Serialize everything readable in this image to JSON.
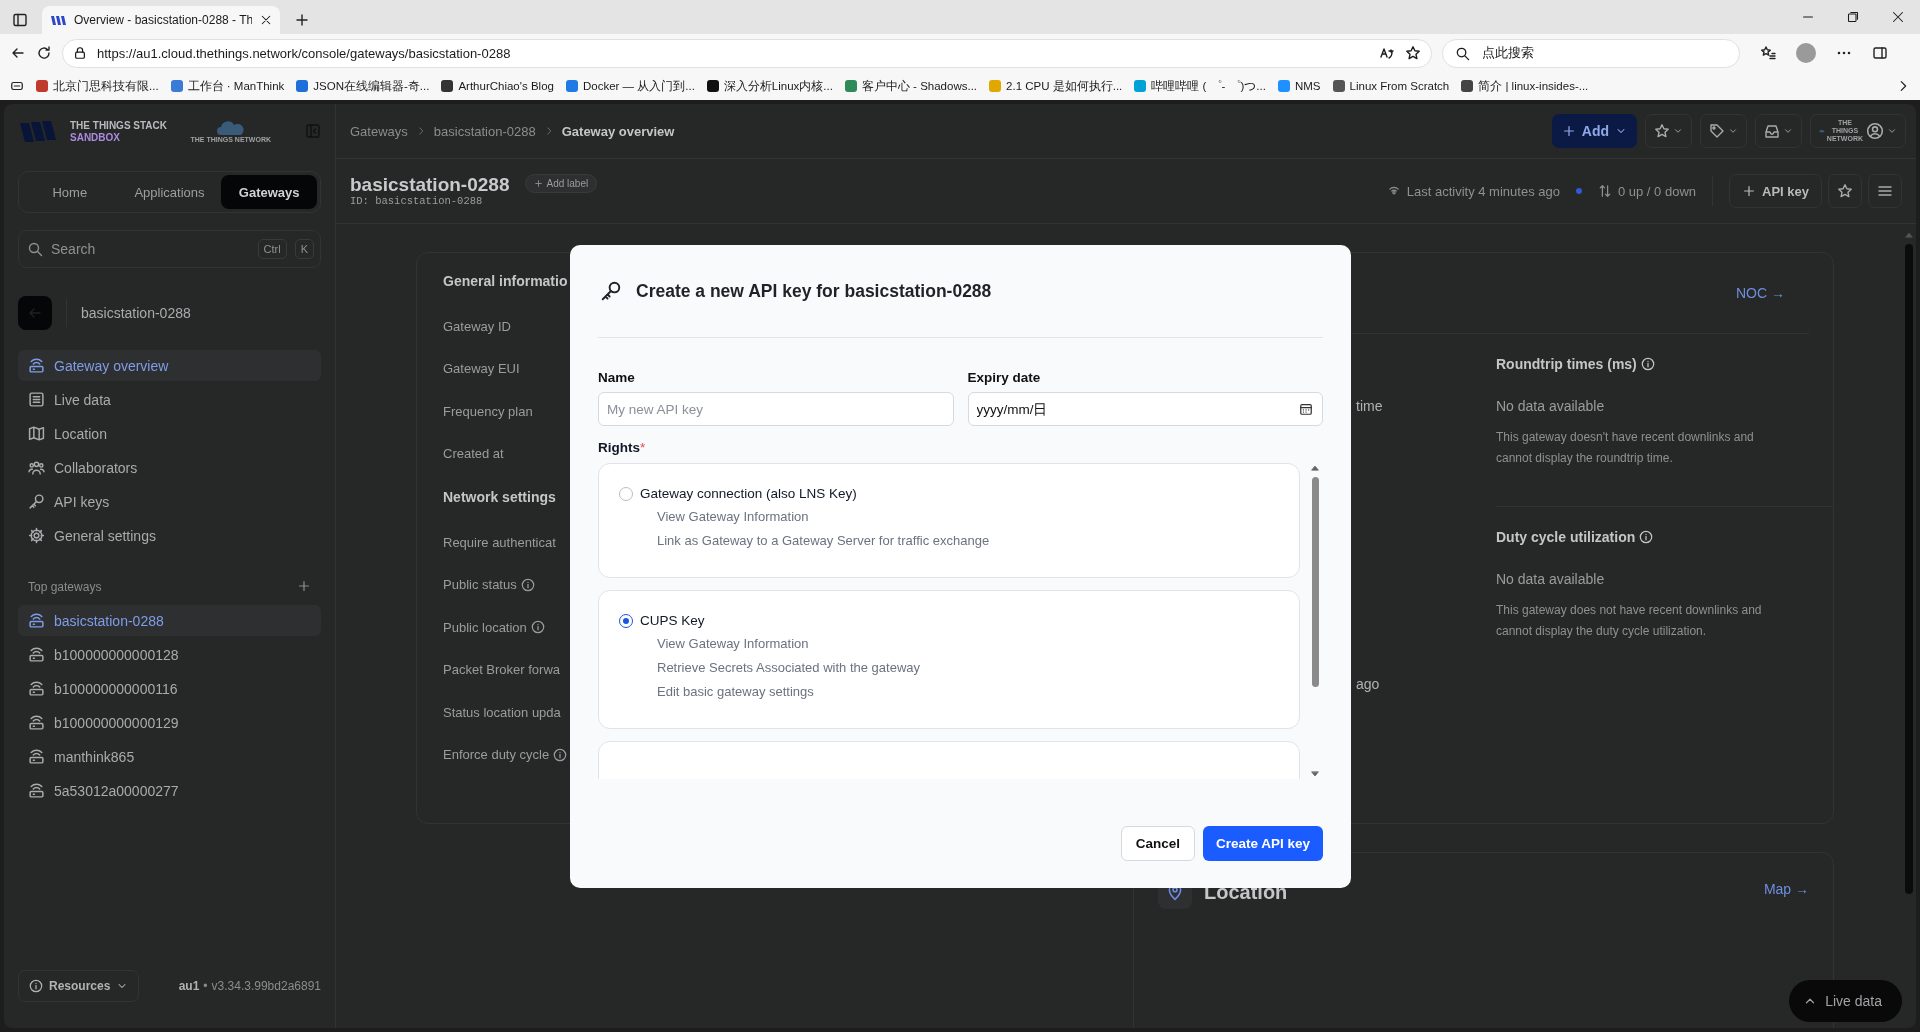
{
  "browser": {
    "tabs": [
      {
        "title": "Overview - basicstation-0288 - Th",
        "selected": true
      }
    ],
    "url": "https://au1.cloud.thethings.network/console/gateways/basicstation-0288",
    "search_placeholder": "点此搜索",
    "bookmarks": [
      "北京门思科技有限...",
      "工作台 · ManThink",
      "JSON在线编辑器-奇...",
      "ArthurChiao's Blog",
      "Docker — 从入门到...",
      "深入分析Linux内核...",
      "客户中心 - Shadows...",
      "2.1 CPU 是如何执行...",
      "哔哩哔哩 ( ゜- ゜)つ...",
      "NMS",
      "Linux From Scratch",
      "简介 | linux-insides-..."
    ]
  },
  "sidebar": {
    "brand": [
      "THE THINGS STACK",
      "SANDBOX"
    ],
    "partner_logo": "THE THINGS NETWORK",
    "nav_tabs": [
      {
        "label": "Home",
        "selected": false
      },
      {
        "label": "Applications",
        "selected": false
      },
      {
        "label": "Gateways",
        "selected": true
      }
    ],
    "search": {
      "placeholder": "Search",
      "keys": [
        "Ctrl",
        "K"
      ]
    },
    "entity": "basicstation-0288",
    "items": [
      {
        "label": "Gateway overview",
        "selected": true
      },
      {
        "label": "Live data",
        "selected": false
      },
      {
        "label": "Location",
        "selected": false
      },
      {
        "label": "Collaborators",
        "selected": false
      },
      {
        "label": "API keys",
        "selected": false
      },
      {
        "label": "General settings",
        "selected": false
      }
    ],
    "top_gateways": {
      "title": "Top gateways",
      "items": [
        {
          "label": "basicstation-0288",
          "selected": true
        },
        {
          "label": "b100000000000128",
          "selected": false
        },
        {
          "label": "b100000000000116",
          "selected": false
        },
        {
          "label": "b100000000000129",
          "selected": false
        },
        {
          "label": "manthink865",
          "selected": false
        },
        {
          "label": "5a53012a00000277",
          "selected": false
        }
      ]
    },
    "footer": {
      "resources": "Resources",
      "region": "au1",
      "separator": "•",
      "version": "v3.34.3.99bd2a6891"
    }
  },
  "header": {
    "breadcrumbs": [
      "Gateways",
      "basicstation-0288",
      "Gateway overview"
    ],
    "add_button": "Add",
    "partner_logo": "THE THINGS NETWORK"
  },
  "title_bar": {
    "title": "basicstation-0288",
    "id": "ID: basicstation-0288",
    "add_label": "Add label",
    "last_activity": "Last activity 4 minutes ago",
    "traffic": "0 up / 0 down",
    "api_key_button": "API key"
  },
  "general_card": {
    "sections": [
      {
        "title": "General informatio",
        "rows": [
          {
            "label": "Gateway ID",
            "info": false
          },
          {
            "label": "Gateway EUI",
            "info": false
          },
          {
            "label": "Frequency plan",
            "info": false
          },
          {
            "label": "Created at",
            "info": false
          }
        ]
      },
      {
        "title": "Network settings",
        "rows": [
          {
            "label": "Require authenticat",
            "info": false
          },
          {
            "label": "Public status",
            "info": true
          },
          {
            "label": "Public location",
            "info": true
          },
          {
            "label": "Packet Broker forwa",
            "info": false
          },
          {
            "label": "Status location upda",
            "info": false
          },
          {
            "label": "Enforce duty cycle",
            "info": true
          }
        ]
      }
    ]
  },
  "status_card": {
    "link": "NOC →",
    "fragments": [
      "time",
      "ago"
    ],
    "stats": [
      {
        "title": "Roundtrip times (ms)",
        "value": "No data available",
        "note": "This gateway doesn't have recent downlinks and cannot display the roundtrip time."
      },
      {
        "title": "Duty cycle utilization",
        "value": "No data available",
        "note": "This gateway does not have recent downlinks and cannot display the duty cycle utilization."
      }
    ]
  },
  "location_card": {
    "title": "Location",
    "link": "Map →"
  },
  "live_data_button": "Live data",
  "modal": {
    "title": "Create a new API key for basicstation-0288",
    "name": {
      "label": "Name",
      "placeholder": "My new API key"
    },
    "expiry": {
      "label": "Expiry date",
      "placeholder": "yyyy/mm/日"
    },
    "rights": {
      "label": "Rights",
      "required_mark": "*",
      "items": [
        {
          "title": "Gateway connection (also LNS Key)",
          "selected": false,
          "details": [
            "View Gateway Information",
            "Link as Gateway to a Gateway Server for traffic exchange"
          ]
        },
        {
          "title": "CUPS Key",
          "selected": true,
          "details": [
            "View Gateway Information",
            "Retrieve Secrets Associated with the gateway",
            "Edit basic gateway settings"
          ]
        }
      ]
    },
    "buttons": {
      "cancel": "Cancel",
      "create": "Create API key"
    }
  }
}
